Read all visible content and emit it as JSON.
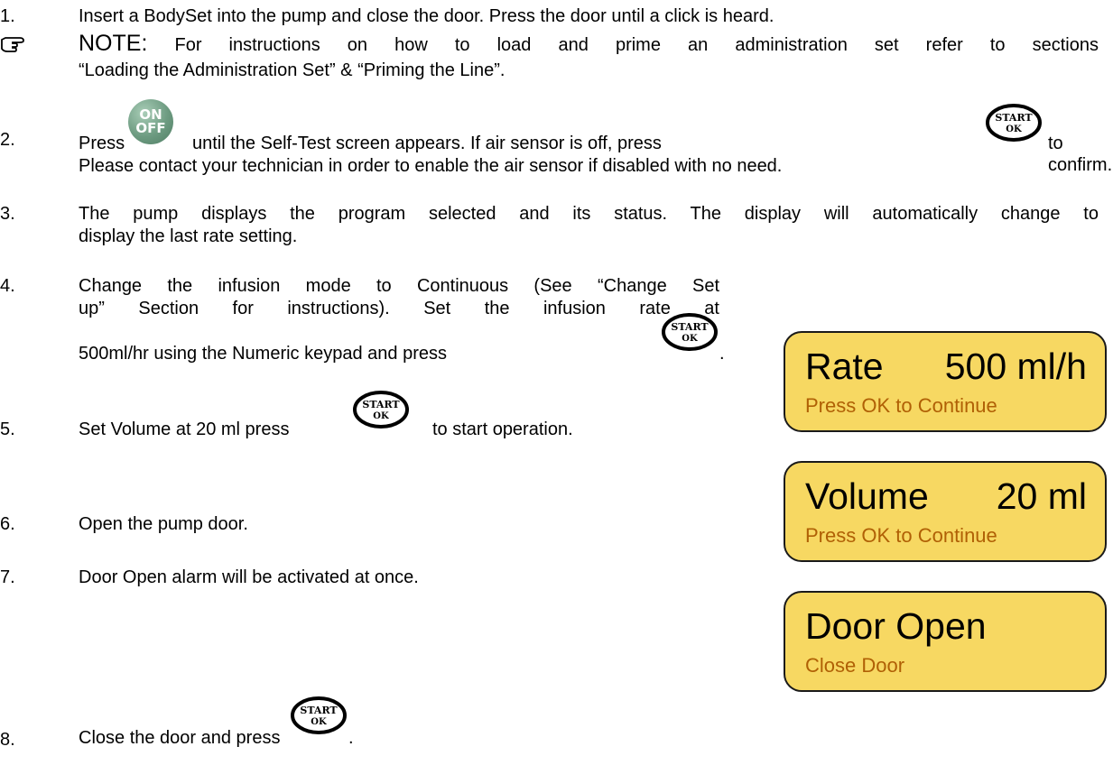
{
  "steps": [
    {
      "num": "1.",
      "lines": [
        "Insert a BodySet  into the pump and close the door. Press the door until a click is heard."
      ]
    },
    {
      "num": "2.",
      "line1_a": "Press",
      "line1_b": "until the Self-Test screen appears. If air sensor is off, press",
      "line1_c": "to confirm.",
      "line2": "Please contact your technician in order to enable the air sensor if disabled with no need."
    },
    {
      "num": "3.",
      "line1": "The pump displays the program selected and its status. The display will automatically change to",
      "line2": "display the last rate setting."
    },
    {
      "num": "4.",
      "line1": "Change the infusion mode to Continuous (See “Change Set",
      "line2": "up” Section for instructions). Set the infusion rate at",
      "line3": "500ml/hr using the Numeric keypad and press",
      "line3_end": "."
    },
    {
      "num": "5.",
      "line1_a": "Set Volume at 20 ml press",
      "line1_b": "to start operation."
    },
    {
      "num": "6.",
      "line1": "Open the pump door."
    },
    {
      "num": "7.",
      "line1": "Door Open alarm will be activated at once."
    },
    {
      "num": "8.",
      "line1": "Close the door and press",
      "line1_end": "."
    }
  ],
  "note": {
    "icon": "pointing-hand-icon",
    "heading": "NOTE:",
    "line1": "For instructions on how to load and prime an administration set refer to sections",
    "line2": "“Loading the Administration Set” & “Priming the Line”."
  },
  "buttons": {
    "onoff_top": "ON",
    "onoff_bottom": "OFF",
    "start_top": "START",
    "start_bottom": "OK"
  },
  "screens": [
    {
      "label": "Rate",
      "value": "500 ml/h",
      "message": "Press OK to Continue"
    },
    {
      "label": "Volume",
      "value": "20 ml",
      "message": "Press OK to Continue"
    },
    {
      "label": "Door Open",
      "value": "",
      "message": "Close Door"
    }
  ],
  "colors": {
    "lcd_background": "#f7d862",
    "lcd_message": "#b06005",
    "onoff_button": "#6d9b81"
  }
}
